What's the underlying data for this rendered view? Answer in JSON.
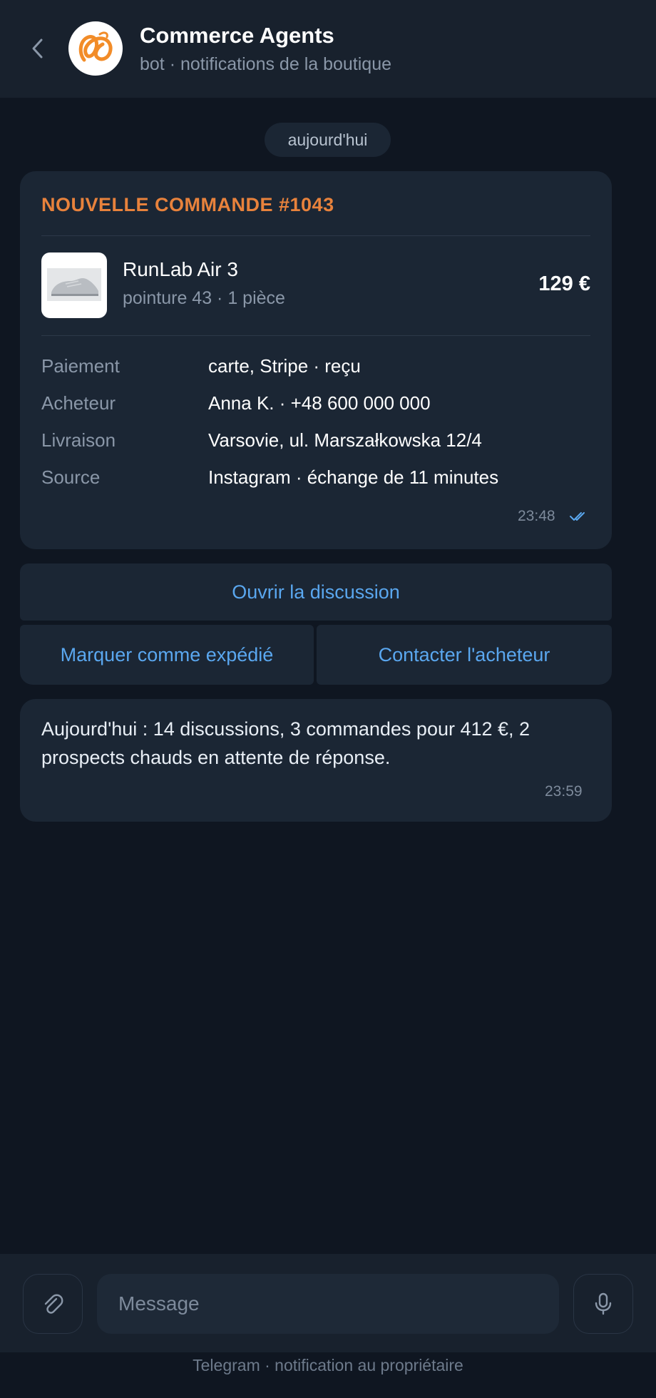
{
  "header": {
    "title": "Commerce Agents",
    "subtitle": "bot · notifications de la boutique",
    "back_icon": "chevron-left-icon",
    "avatar_icon": "spiral-logo-icon",
    "accent": "#f28c28"
  },
  "date_separator": "aujourd'hui",
  "order": {
    "title": "NOUVELLE COMMANDE #1043",
    "product": {
      "name": "RunLab Air 3",
      "meta": "pointure 43 · 1 pièce",
      "price": "129 €",
      "image_icon": "sneaker-icon"
    },
    "details": [
      {
        "label": "Paiement",
        "value": "carte, Stripe · reçu"
      },
      {
        "label": "Acheteur",
        "value": "Anna K. · +48 600 000 000"
      },
      {
        "label": "Livraison",
        "value": "Varsovie, ul. Marszałkowska 12/4"
      },
      {
        "label": "Source",
        "value": "Instagram · échange de 11 minutes"
      }
    ],
    "time": "23:48",
    "status_icon": "double-check-icon",
    "title_color": "#e8823c"
  },
  "buttons": {
    "open_chat": "Ouvrir la discussion",
    "mark_shipped": "Marquer comme expédié",
    "contact_buyer": "Contacter l'acheteur",
    "link_color": "#5aa7ef"
  },
  "summary": {
    "text": "Aujourd'hui : 14 discussions, 3 commandes pour 412 €, 2 prospects chauds en attente de réponse.",
    "time": "23:59"
  },
  "composer": {
    "placeholder": "Message",
    "attach_icon": "paperclip-icon",
    "mic_icon": "microphone-icon"
  },
  "footer": "Telegram · notification au propriétaire"
}
